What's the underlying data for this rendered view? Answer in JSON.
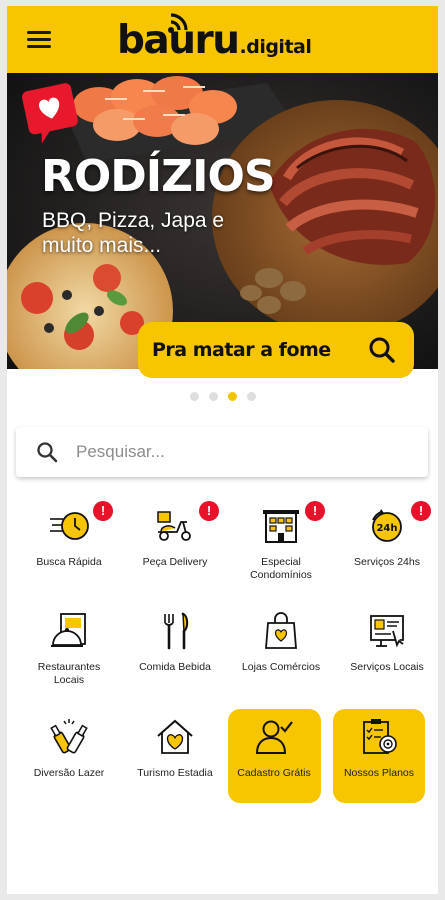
{
  "header": {
    "logo_main": "bauru",
    "logo_sub": ".digital",
    "accent": "#f7c600"
  },
  "banner": {
    "title": "RODÍZIOS",
    "subtitle": "BBQ, Pizza, Japa e muito mais...",
    "cta_label": "Pra matar a fome",
    "slides_total": 4,
    "active_slide": 3
  },
  "search": {
    "placeholder": "Pesquisar..."
  },
  "tiles": [
    {
      "label": "Busca Rápida",
      "icon": "fast-clock-icon",
      "badge": "!"
    },
    {
      "label": "Peça Delivery",
      "icon": "delivery-scooter-icon",
      "badge": "!"
    },
    {
      "label": "Especial Condomínios",
      "icon": "building-icon",
      "badge": "!"
    },
    {
      "label": "Serviços 24hs",
      "icon": "clock-24h-icon",
      "badge": "!"
    },
    {
      "label": "Restaurantes Locais",
      "icon": "restaurant-menu-icon"
    },
    {
      "label": "Comida Bebida",
      "icon": "fork-knife-icon"
    },
    {
      "label": "Lojas Comércios",
      "icon": "shopping-bag-icon"
    },
    {
      "label": "Serviços Locais",
      "icon": "service-screen-icon"
    },
    {
      "label": "Diversão Lazer",
      "icon": "bottles-cheers-icon"
    },
    {
      "label": "Turismo Estadia",
      "icon": "home-heart-icon"
    },
    {
      "label": "Cadastro Grátis",
      "icon": "user-check-icon"
    },
    {
      "label": "Nossos Planos",
      "icon": "plan-target-icon"
    }
  ]
}
